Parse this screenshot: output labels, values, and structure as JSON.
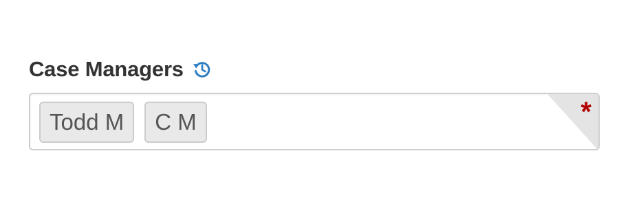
{
  "field": {
    "label": "Case Managers",
    "history_icon": "history-icon",
    "required_marker": "*",
    "tokens": [
      {
        "label": "Todd M"
      },
      {
        "label": "C M"
      }
    ]
  },
  "colors": {
    "label": "#333333",
    "icon": "#2f7ec1",
    "token_bg": "#e9e9e9",
    "required": "#b30000"
  }
}
